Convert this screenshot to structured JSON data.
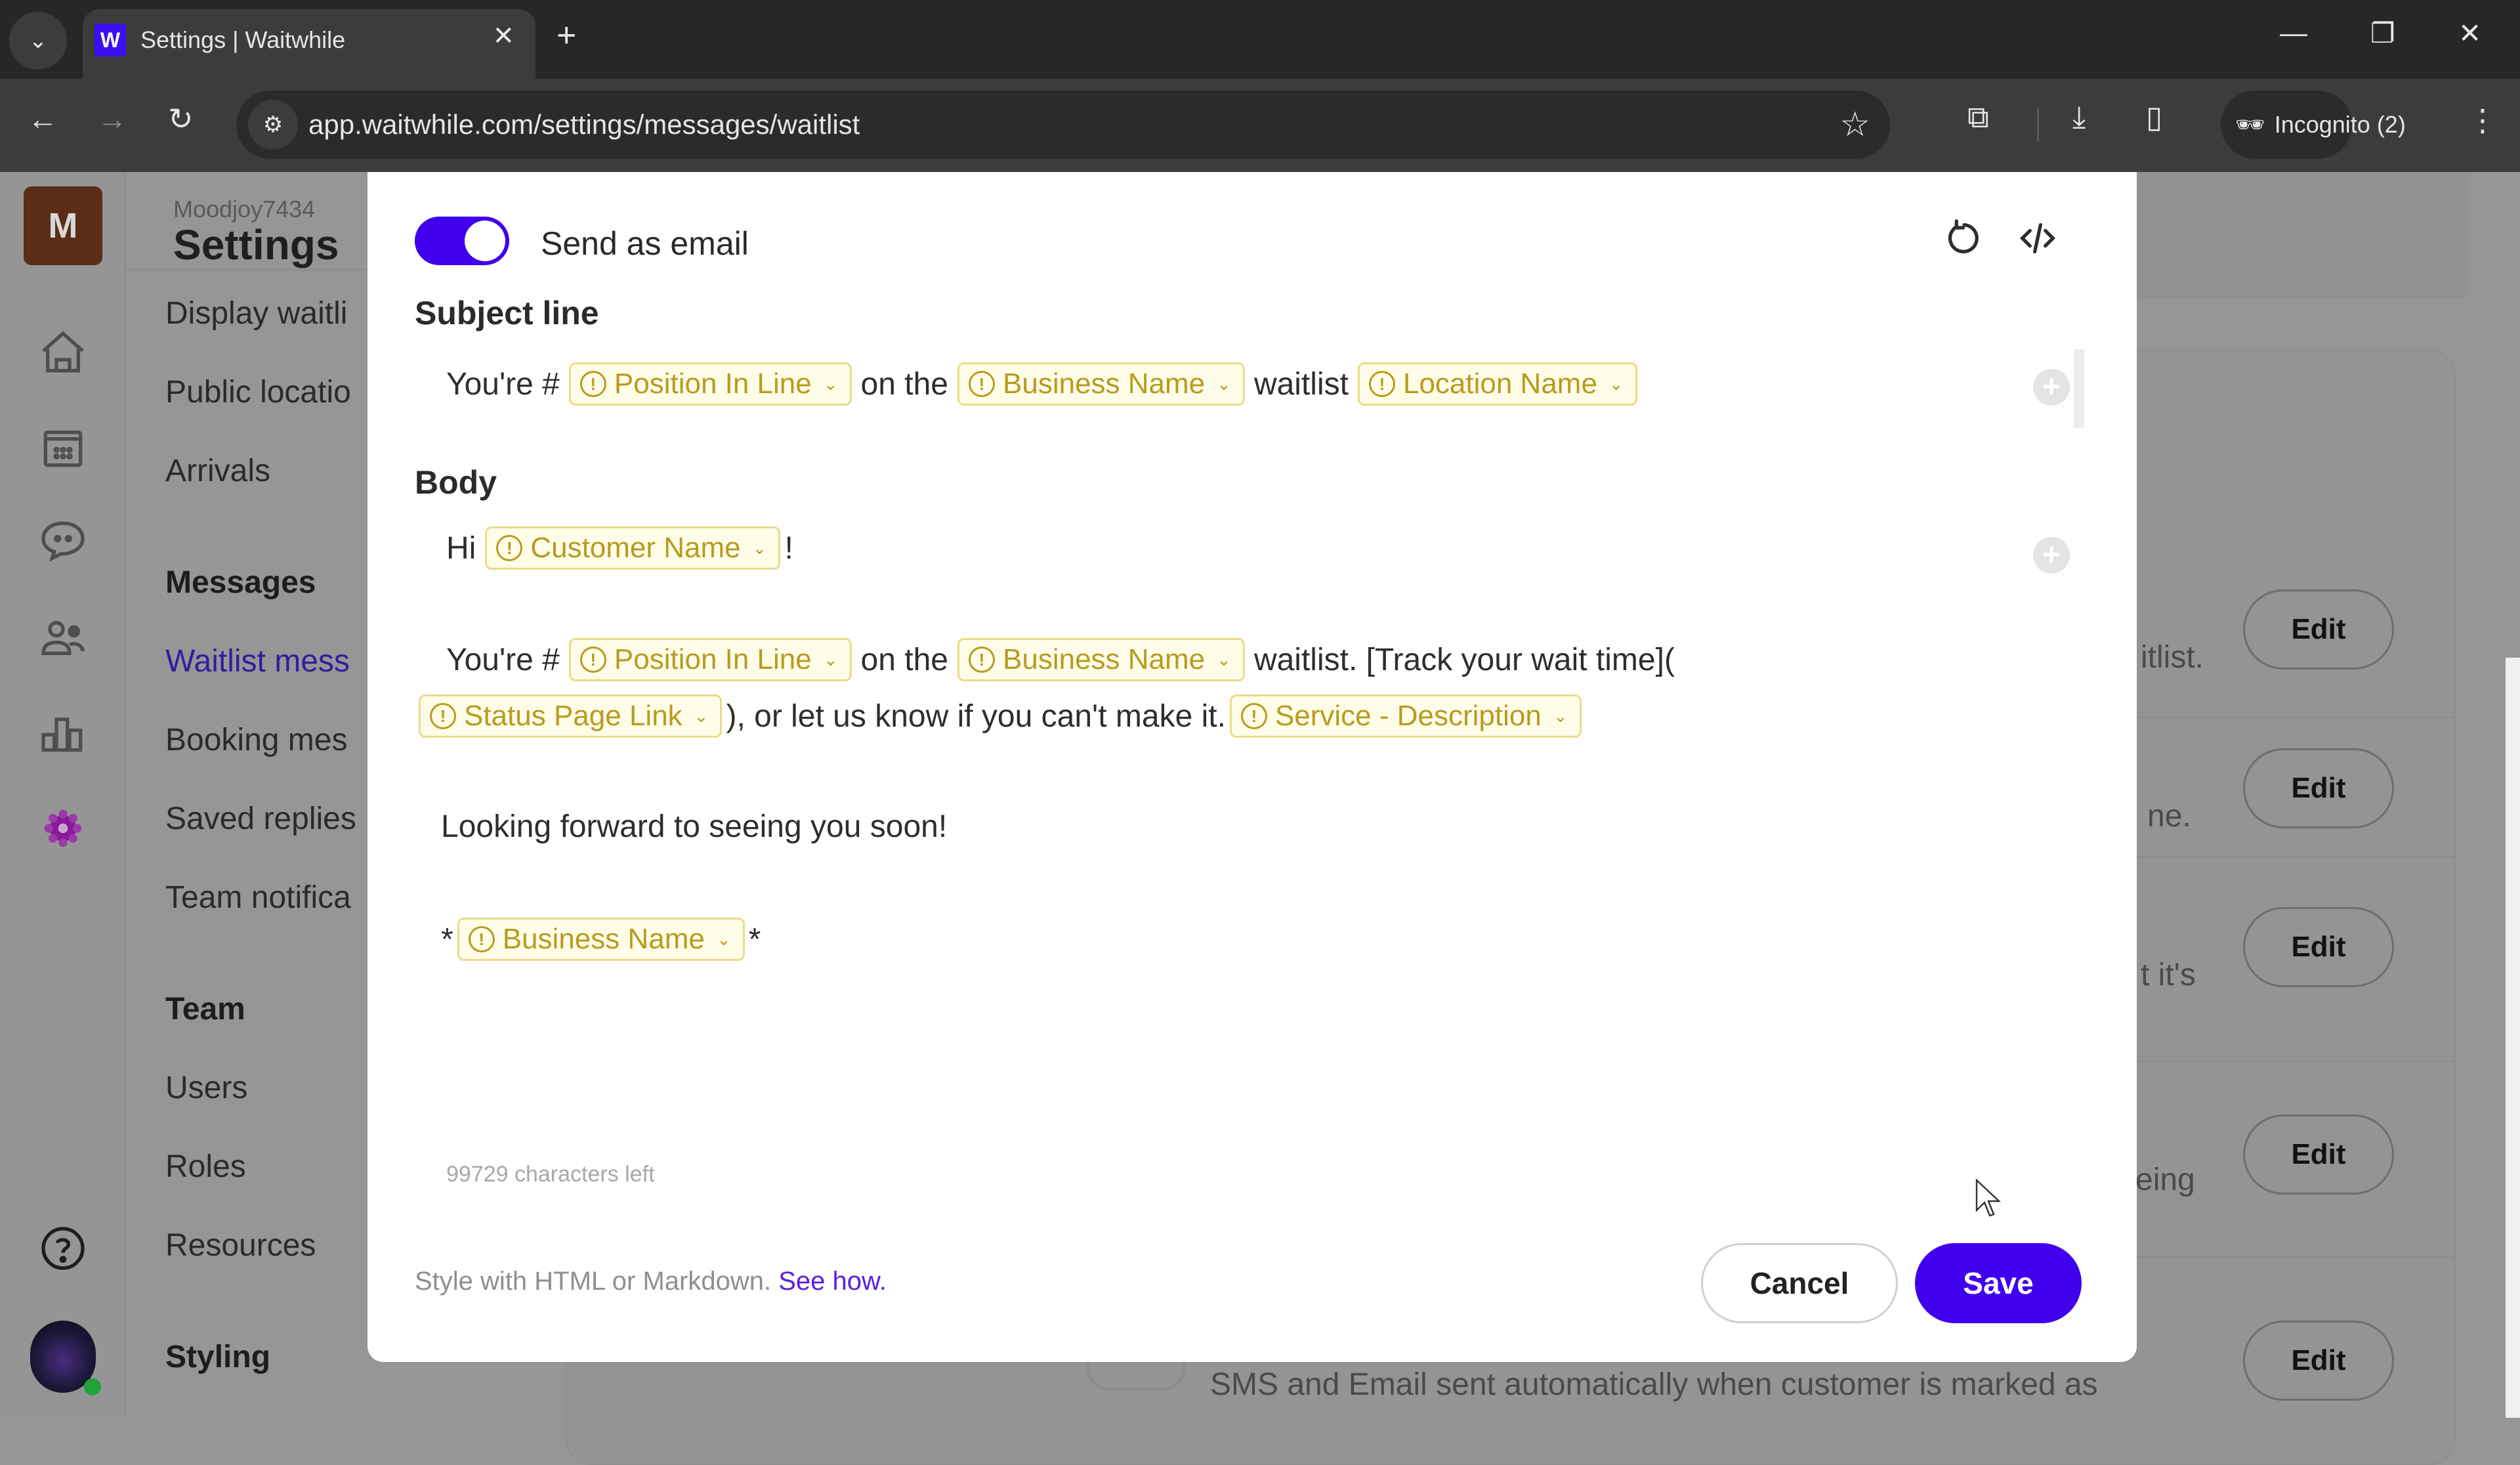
{
  "browser": {
    "tab_title": "Settings | Waitwhile",
    "favicon_letter": "W",
    "url": "app.waitwhile.com/settings/messages/waitlist",
    "incognito_label": "Incognito (2)"
  },
  "rail": {
    "org_initial": "M",
    "icons": [
      "home-icon",
      "calendar-icon",
      "chat-icon",
      "users-icon",
      "analytics-icon",
      "settings-icon",
      "help-icon"
    ]
  },
  "subnav": {
    "org_name": "Moodjoy7434",
    "title": "Settings",
    "items": [
      {
        "label": "Display waitli",
        "type": "item"
      },
      {
        "label": "Public locatio",
        "type": "item"
      },
      {
        "label": "Arrivals",
        "type": "item"
      },
      {
        "label": "Messages",
        "type": "section"
      },
      {
        "label": "Waitlist mess",
        "type": "item",
        "active": true
      },
      {
        "label": "Booking mes",
        "type": "item"
      },
      {
        "label": "Saved replies",
        "type": "item"
      },
      {
        "label": "Team notifica",
        "type": "item"
      },
      {
        "label": "Team",
        "type": "section"
      },
      {
        "label": "Users",
        "type": "item"
      },
      {
        "label": "Roles",
        "type": "item"
      },
      {
        "label": "Resources",
        "type": "item"
      },
      {
        "label": "Styling",
        "type": "section"
      }
    ]
  },
  "background_rows": [
    {
      "text": "itlist.",
      "button": "Edit"
    },
    {
      "text": "ne.",
      "button": "Edit"
    },
    {
      "text": "t it's",
      "button": "Edit"
    },
    {
      "text": "eing",
      "button": "Edit"
    },
    {
      "text": "SMS and Email sent automatically when customer is marked as",
      "button": "Edit"
    }
  ],
  "modal": {
    "send_as_email_label": "Send as email",
    "send_as_email_on": true,
    "subject_label": "Subject line",
    "subject": {
      "t1": "You're #",
      "c1": "Position In Line",
      "t2": "on the",
      "c2": "Business Name",
      "t3": "waitlist",
      "c3": "Location Name"
    },
    "body_label": "Body",
    "body": {
      "l1_t1": "Hi",
      "l1_c1": "Customer Name",
      "l1_t2": "!",
      "l2_t1": "You're #",
      "l2_c1": "Position In Line",
      "l2_t2": "on the",
      "l2_c2": "Business Name",
      "l2_t3": "waitlist. [Track your wait time](",
      "l3_c1": "Status Page Link",
      "l3_t1": "), or let us know if you can't make it.",
      "l3_c2": "Service - Description",
      "l4_t1": "Looking forward to seeing you soon!",
      "l5_t1": "*",
      "l5_c1": "Business Name",
      "l5_t2": "*"
    },
    "chars_left": "99729 characters left",
    "style_hint": "Style with HTML or Markdown.",
    "see_how": "See how.",
    "cancel_label": "Cancel",
    "save_label": "Save",
    "accent_color": "#4000ed",
    "chip_color": "#b89b20"
  }
}
